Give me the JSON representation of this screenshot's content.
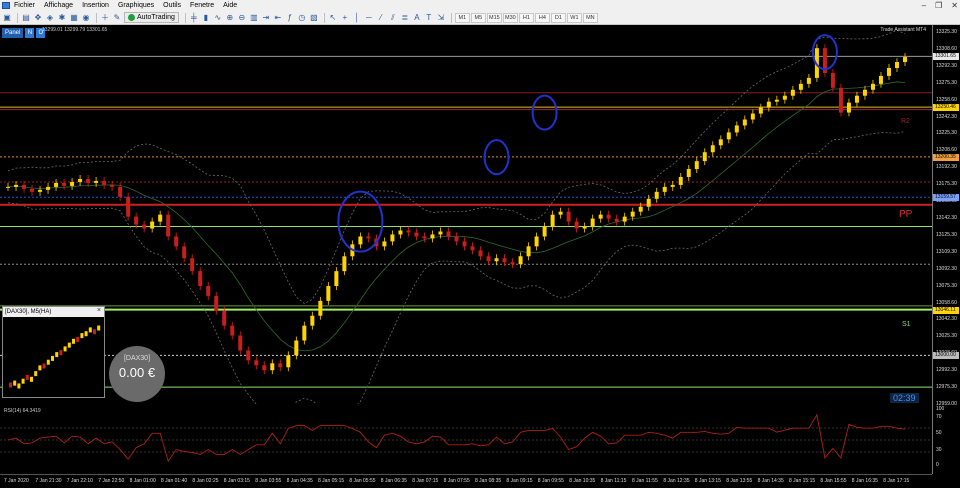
{
  "menu": {
    "items": [
      "Fichier",
      "Affichage",
      "Insertion",
      "Graphiques",
      "Outils",
      "Fenetre",
      "Aide"
    ]
  },
  "toolbar": {
    "autotrading_label": "AutoTrading",
    "timeframes": [
      "M1",
      "M5",
      "M15",
      "M30",
      "H1",
      "H4",
      "D1",
      "W1",
      "MN"
    ]
  },
  "chart": {
    "panel_label": "Panel",
    "panel_btn_n": "N",
    "panel_btn_o": "O",
    "ohlc_text": "13299.01 13299.79 13301.65",
    "assistant_title": "Trade Assistant MT4",
    "countdown": "02:39",
    "pivot_pp": "PP",
    "pivot_s1": "S1",
    "pivot_r2": "R2"
  },
  "mini_chart": {
    "title": "[DAX30], M5(HA)",
    "close": "×"
  },
  "balance": {
    "symbol": "[DAX30]",
    "value": "0.00 €"
  },
  "rsi": {
    "label": "RSI(14) 64.3419",
    "levels": [
      "100",
      "70",
      "50",
      "30",
      "0"
    ]
  },
  "price_axis": {
    "labels": [
      "13325.30",
      "13308.60",
      "13292.30",
      "13275.30",
      "13258.60",
      "13242.30",
      "13225.30",
      "13208.60",
      "13192.30",
      "13175.30",
      "13158.60",
      "13142.30",
      "13125.30",
      "13109.30",
      "13092.30",
      "13075.30",
      "13058.60",
      "13042.30",
      "13025.30",
      "13008.60",
      "12992.30",
      "12975.30",
      "12959.00"
    ],
    "tags": [
      {
        "text": "13301.65",
        "color": "#e8e8e8"
      },
      {
        "text": "13250.46",
        "color": "#ffd400"
      },
      {
        "text": "13200.35",
        "color": "#f0a040"
      },
      {
        "text": "13159.57",
        "color": "#7aa0ff"
      },
      {
        "text": "13046.11",
        "color": "#ffd400"
      },
      {
        "text": "13000.00",
        "color": "#bbbbbb"
      }
    ]
  },
  "time_axis": {
    "labels": [
      "7 Jan 2020",
      "7 Jan 21:30",
      "7 Jan 22:10",
      "7 Jan 22:50",
      "8 Jan 01:00",
      "8 Jan 01:40",
      "8 Jan 02:25",
      "8 Jan 03:15",
      "8 Jan 03:55",
      "8 Jan 04:35",
      "8 Jan 05:15",
      "8 Jan 05:55",
      "8 Jan 06:35",
      "8 Jan 07:15",
      "8 Jan 07:55",
      "8 Jan 08:35",
      "8 Jan 09:15",
      "8 Jan 09:55",
      "8 Jan 10:35",
      "8 Jan 11:15",
      "8 Jan 11:55",
      "8 Jan 12:35",
      "8 Jan 13:15",
      "8 Jan 13:55",
      "8 Jan 14:35",
      "8 Jan 15:15",
      "8 Jan 15:55",
      "8 Jan 16:35",
      "8 Jan 17:15"
    ]
  },
  "chart_data": {
    "type": "candlestick",
    "title": "DAX30, M5",
    "ylim": [
      12959.0,
      13325.3
    ],
    "candles": [
      13170,
      13172,
      13168,
      13165,
      13167,
      13170,
      13174,
      13171,
      13175,
      13178,
      13174,
      13176,
      13172,
      13170,
      13160,
      13140,
      13132,
      13128,
      13135,
      13142,
      13120,
      13110,
      13098,
      13085,
      13070,
      13060,
      13045,
      13030,
      13020,
      13005,
      12995,
      12990,
      12985,
      12992,
      12988,
      13000,
      13015,
      13030,
      13040,
      13055,
      13070,
      13085,
      13100,
      13112,
      13120,
      13118,
      13110,
      13115,
      13122,
      13126,
      13124,
      13120,
      13118,
      13122,
      13125,
      13120,
      13115,
      13110,
      13106,
      13100,
      13095,
      13098,
      13094,
      13092,
      13100,
      13110,
      13120,
      13130,
      13142,
      13145,
      13135,
      13128,
      13130,
      13138,
      13142,
      13138,
      13135,
      13140,
      13145,
      13150,
      13158,
      13165,
      13170,
      13172,
      13180,
      13188,
      13196,
      13205,
      13212,
      13218,
      13225,
      13232,
      13238,
      13244,
      13250,
      13256,
      13258,
      13262,
      13268,
      13274,
      13280,
      13310,
      13285,
      13270,
      13245,
      13255,
      13262,
      13268,
      13274,
      13282,
      13290,
      13296,
      13301
    ],
    "rsi": {
      "levels": [
        70,
        50,
        30
      ],
      "last": 64.3419
    }
  }
}
